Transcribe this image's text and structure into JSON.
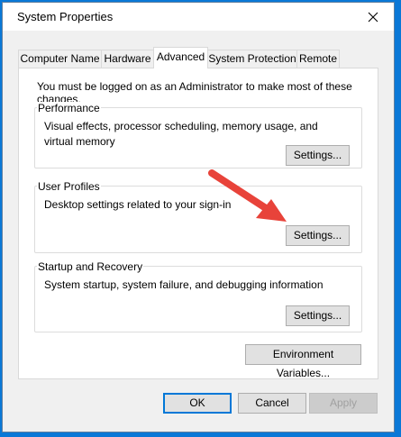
{
  "window": {
    "title": "System Properties",
    "close_glyph": "✕"
  },
  "tabs": [
    {
      "label": "Computer Name",
      "active": false
    },
    {
      "label": "Hardware",
      "active": false
    },
    {
      "label": "Advanced",
      "active": true
    },
    {
      "label": "System Protection",
      "active": false
    },
    {
      "label": "Remote",
      "active": false
    }
  ],
  "advanced": {
    "notice": "You must be logged on as an Administrator to make most of these changes.",
    "performance": {
      "label": "Performance",
      "description": "Visual effects, processor scheduling, memory usage, and virtual memory",
      "button": "Settings..."
    },
    "user_profiles": {
      "label": "User Profiles",
      "description": "Desktop settings related to your sign-in",
      "button": "Settings..."
    },
    "startup_recovery": {
      "label": "Startup and Recovery",
      "description": "System startup, system failure, and debugging information",
      "button": "Settings..."
    },
    "environment_variables_button": "Environment Variables..."
  },
  "footer": {
    "ok": "OK",
    "cancel": "Cancel",
    "apply": "Apply"
  },
  "colors": {
    "desktop_background": "#0a78d7",
    "annotation_arrow": "#e8433a",
    "focus_border": "#0078d7"
  },
  "icons": {
    "close": "close-icon",
    "annotation": "red-arrow-annotation"
  }
}
